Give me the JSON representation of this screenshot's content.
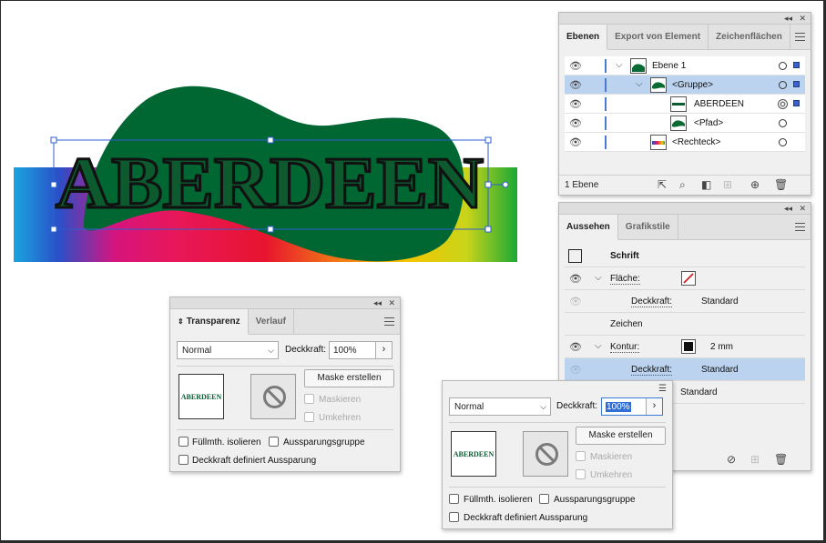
{
  "artwork": {
    "text": "ABERDEEN",
    "colors": {
      "blob": "#006632",
      "text_fill": "#0d5a2f",
      "text_stroke": "#111111",
      "selection": "#2f5fd0"
    }
  },
  "layers_panel": {
    "tabs": [
      "Ebenen",
      "Export von Element",
      "Zeichenflächen"
    ],
    "active_tab": "Ebenen",
    "layers": [
      {
        "label": "Ebene 1",
        "thumb": "layer-thumb",
        "selected": false
      },
      {
        "label": "<Gruppe>",
        "thumb": "group-thumb",
        "selected": true
      },
      {
        "label": "ABERDEEN",
        "thumb": "text-thumb",
        "selected": false
      },
      {
        "label": "<Pfad>",
        "thumb": "path-thumb",
        "selected": false
      },
      {
        "label": "<Rechteck>",
        "thumb": "rect-thumb",
        "selected": false
      }
    ],
    "footer_count": "1 Ebene",
    "footer_icons": [
      "export-icon",
      "search-icon",
      "mask-icon",
      "new-sublayer-icon",
      "new-layer-icon",
      "trash-icon"
    ]
  },
  "appearance_panel": {
    "tabs": [
      "Aussehen",
      "Grafikstile"
    ],
    "active_tab": "Aussehen",
    "title": "Schrift",
    "flaeche_label": "Fläche:",
    "deckkraft_label": "Deckkraft:",
    "deckkraft_value": "Standard",
    "zeichen_label": "Zeichen",
    "kontur_label": "Kontur:",
    "kontur_value": "2 mm",
    "deckkraft2_label": "Deckkraft:",
    "deckkraft2_value": "Standard",
    "deckkraft3_value": "Standard"
  },
  "transparency_panel": {
    "tabs": [
      "Transparenz",
      "Verlauf"
    ],
    "active_tab": "Transparenz",
    "blend_mode": "Normal",
    "opacity_label": "Deckkraft:",
    "opacity_value": "100%",
    "mask_button": "Maske erstellen",
    "clip_label": "Maskieren",
    "invert_label": "Umkehren",
    "preview_text": "ABERDEEN",
    "isolate_label": "Füllmth. isolieren",
    "knockout_label": "Aussparungsgruppe",
    "opacity_knockout_label": "Deckkraft definiert Aussparung"
  },
  "floating_transparency": {
    "blend_mode": "Normal",
    "opacity_label": "Deckkraft:",
    "opacity_value": "100%",
    "mask_button": "Maske erstellen",
    "clip_label": "Maskieren",
    "invert_label": "Umkehren",
    "preview_text": "ABERDEEN",
    "isolate_label": "Füllmth. isolieren",
    "knockout_label": "Aussparungsgruppe",
    "opacity_knockout_label": "Deckkraft definiert Aussparung"
  }
}
